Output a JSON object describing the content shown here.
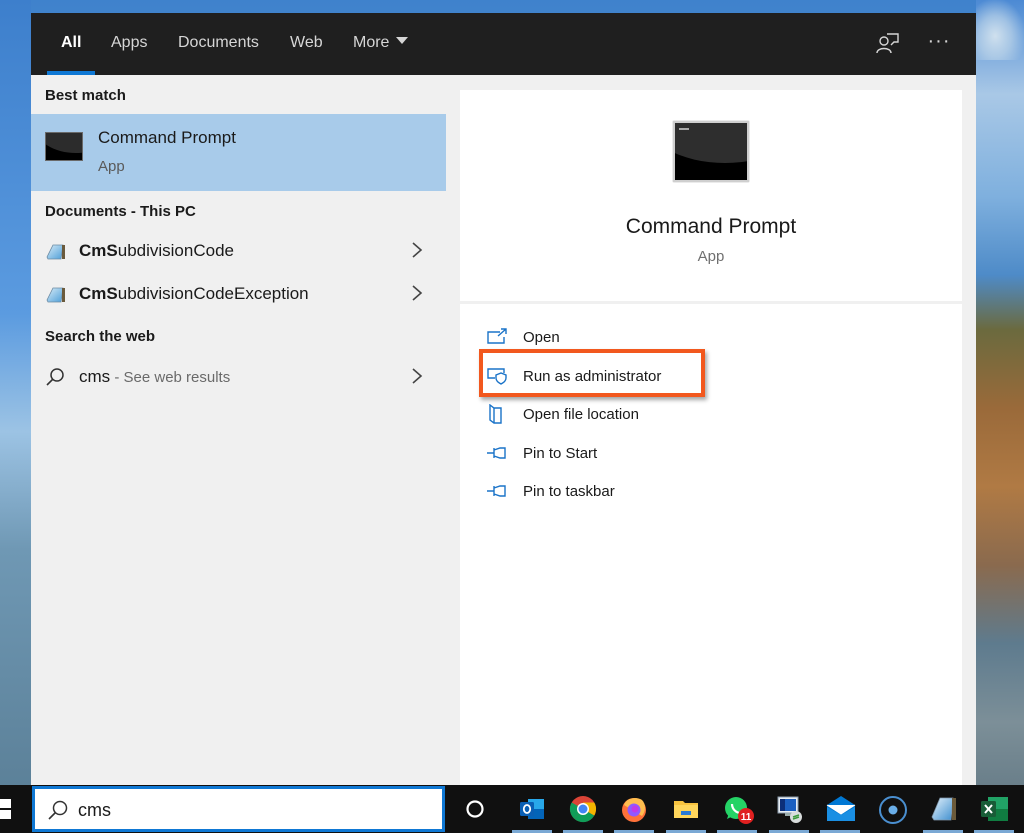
{
  "tabs": [
    {
      "label": "All",
      "active": true
    },
    {
      "label": "Apps",
      "active": false
    },
    {
      "label": "Documents",
      "active": false
    },
    {
      "label": "Web",
      "active": false
    },
    {
      "label": "More",
      "active": false,
      "has_dropdown": true
    }
  ],
  "top_icons": [
    {
      "name": "feedback-icon"
    },
    {
      "name": "more-options-icon",
      "glyph": "···"
    }
  ],
  "results": {
    "best_match_header": "Best match",
    "best_match": {
      "title": "Command Prompt",
      "subtitle": "App",
      "icon": "command-prompt-icon"
    },
    "documents_header": "Documents - This PC",
    "documents": [
      {
        "match": "CmS",
        "rest": "ubdivisionCode",
        "icon": "notepad-document-icon"
      },
      {
        "match": "CmS",
        "rest": "ubdivisionCodeException",
        "icon": "notepad-document-icon"
      }
    ],
    "web_header": "Search the web",
    "web": {
      "query": "cms",
      "suffix": " - See web results",
      "icon": "search-icon"
    }
  },
  "preview": {
    "title": "Command Prompt",
    "subtitle": "App",
    "actions": [
      {
        "label": "Open",
        "icon": "open-icon"
      },
      {
        "label": "Run as administrator",
        "icon": "admin-shield-icon",
        "highlighted": true
      },
      {
        "label": "Open file location",
        "icon": "file-location-icon"
      },
      {
        "label": "Pin to Start",
        "icon": "pin-icon"
      },
      {
        "label": "Pin to taskbar",
        "icon": "pin-icon"
      }
    ],
    "highlight_color": "#f2581e"
  },
  "taskbar": {
    "search_value": "cms",
    "apps": [
      {
        "name": "task-view"
      },
      {
        "name": "outlook"
      },
      {
        "name": "chrome"
      },
      {
        "name": "firefox"
      },
      {
        "name": "file-explorer"
      },
      {
        "name": "whatsapp",
        "badge": "11"
      },
      {
        "name": "remote-desktop"
      },
      {
        "name": "mail"
      },
      {
        "name": "cortana"
      },
      {
        "name": "notepad"
      },
      {
        "name": "excel"
      }
    ]
  },
  "colors": {
    "accent": "#0f78d4",
    "selection": "#a8cbea",
    "topbar": "#1f1f1f",
    "action_icon": "#1a73c8"
  }
}
